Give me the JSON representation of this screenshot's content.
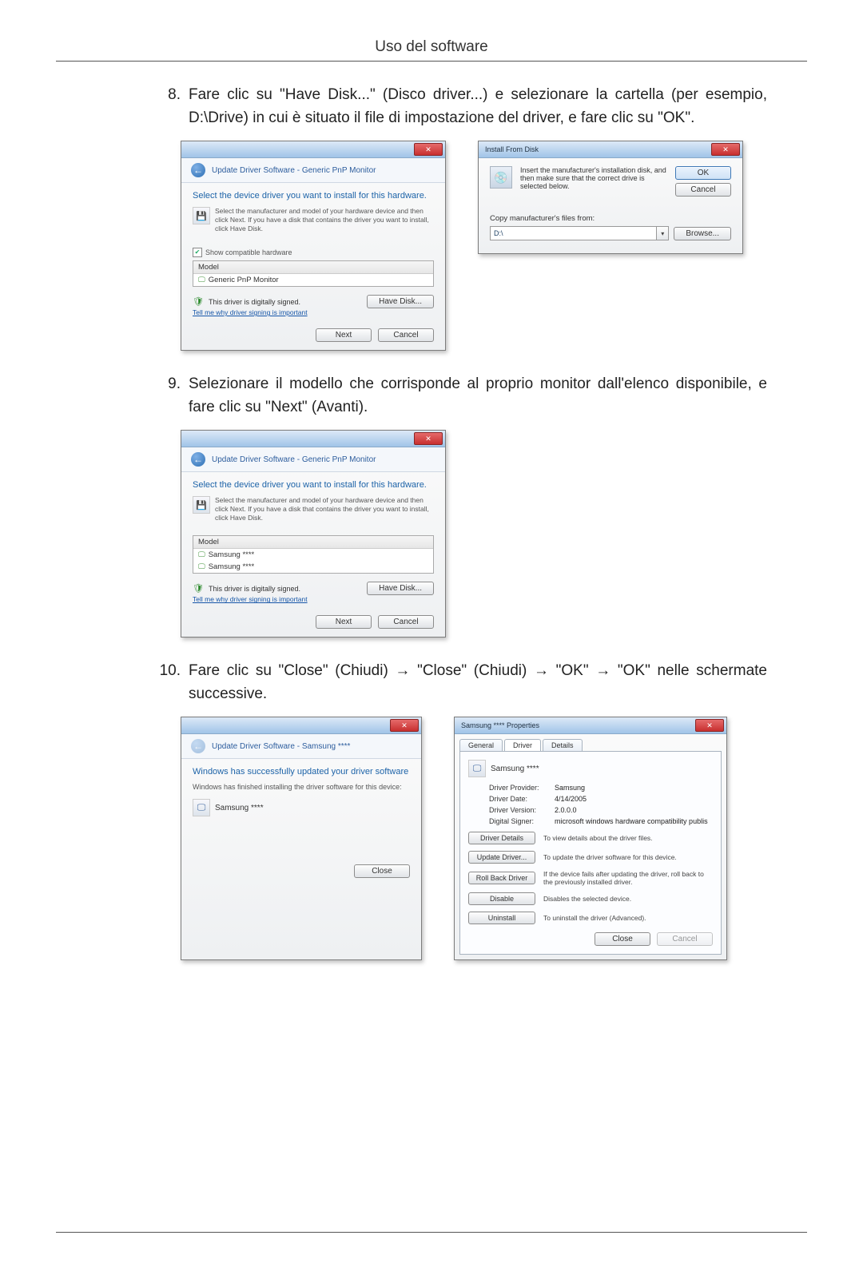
{
  "header": {
    "title": "Uso del software"
  },
  "step8": {
    "num": "8.",
    "text": "Fare clic su \"Have Disk...\" (Disco driver...) e selezionare la cartella (per esempio, D:\\Drive) in cui è situato il file di impostazione del driver, e fare clic su \"OK\"."
  },
  "win1": {
    "crumb": "Update Driver Software - Generic PnP Monitor",
    "heading": "Select the device driver you want to install for this hardware.",
    "desc": "Select the manufacturer and model of your hardware device and then click Next. If you have a disk that contains the driver you want to install, click Have Disk.",
    "checkbox": "Show compatible hardware",
    "listHeader": "Model",
    "listItem": "Generic PnP Monitor",
    "signed": "This driver is digitally signed.",
    "tellme": "Tell me why driver signing is important",
    "haveDisk": "Have Disk...",
    "next": "Next",
    "cancel": "Cancel"
  },
  "ifd": {
    "title": "Install From Disk",
    "msg": "Insert the manufacturer's installation disk, and then make sure that the correct drive is selected below.",
    "ok": "OK",
    "cancel": "Cancel",
    "copyLabel": "Copy manufacturer's files from:",
    "path": "D:\\",
    "browse": "Browse..."
  },
  "step9": {
    "num": "9.",
    "text": "Selezionare il modello che corrisponde al proprio monitor dall'elenco disponibile, e fare clic su \"Next\" (Avanti)."
  },
  "win2": {
    "crumb": "Update Driver Software - Generic PnP Monitor",
    "heading": "Select the device driver you want to install for this hardware.",
    "desc": "Select the manufacturer and model of your hardware device and then click Next. If you have a disk that contains the driver you want to install, click Have Disk.",
    "listHeader": "Model",
    "item1": "Samsung ****",
    "item2": "Samsung ****",
    "signed": "This driver is digitally signed.",
    "tellme": "Tell me why driver signing is important",
    "haveDisk": "Have Disk...",
    "next": "Next",
    "cancel": "Cancel"
  },
  "step10": {
    "num": "10.",
    "text": "Fare clic su \"Close\" (Chiudi) → \"Close\" (Chiudi) → \"OK\" → \"OK\" nelle schermate successive."
  },
  "win3": {
    "crumb": "Update Driver Software - Samsung ****",
    "heading": "Windows has successfully updated your driver software",
    "sub": "Windows has finished installing the driver software for this device:",
    "device": "Samsung ****",
    "close": "Close"
  },
  "props": {
    "title": "Samsung **** Properties",
    "tabGeneral": "General",
    "tabDriver": "Driver",
    "tabDetails": "Details",
    "device": "Samsung ****",
    "kProvider": "Driver Provider:",
    "vProvider": "Samsung",
    "kDate": "Driver Date:",
    "vDate": "4/14/2005",
    "kVersion": "Driver Version:",
    "vVersion": "2.0.0.0",
    "kSigner": "Digital Signer:",
    "vSigner": "microsoft windows hardware compatibility publis",
    "btnDetails": "Driver Details",
    "descDetails": "To view details about the driver files.",
    "btnUpdate": "Update Driver...",
    "descUpdate": "To update the driver software for this device.",
    "btnRollback": "Roll Back Driver",
    "descRollback": "If the device fails after updating the driver, roll back to the previously installed driver.",
    "btnDisable": "Disable",
    "descDisable": "Disables the selected device.",
    "btnUninstall": "Uninstall",
    "descUninstall": "To uninstall the driver (Advanced).",
    "close": "Close",
    "cancel": "Cancel"
  }
}
